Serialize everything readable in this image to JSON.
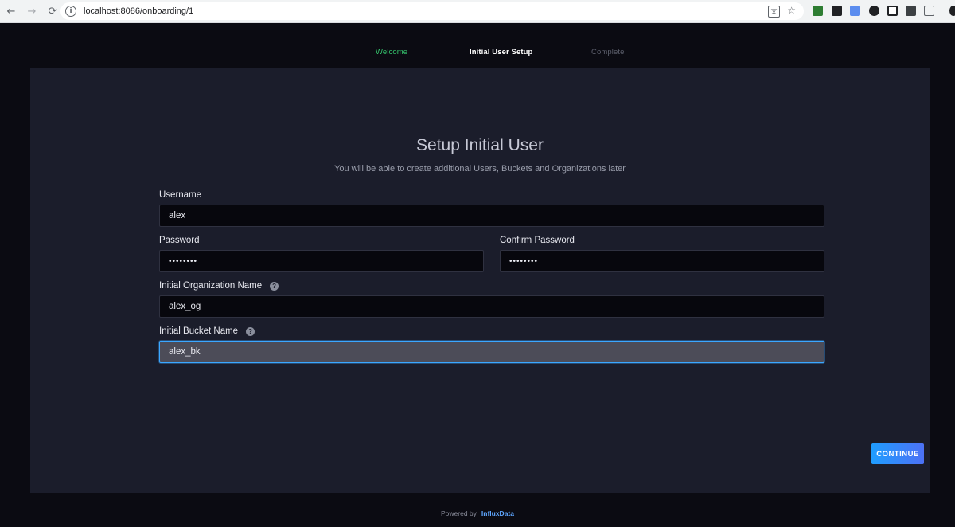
{
  "browser": {
    "url": "localhost:8086/onboarding/1",
    "back_icon": "back-arrow-icon",
    "forward_icon": "forward-arrow-icon",
    "reload_icon": "reload-icon"
  },
  "stepper": {
    "steps": [
      {
        "label": "Welcome",
        "state": "done",
        "color": "#34c16b"
      },
      {
        "label": "Initial User Setup",
        "state": "current",
        "color": "#ffffff"
      },
      {
        "label": "Complete",
        "state": "pending",
        "color": "#5c5f6c"
      }
    ]
  },
  "form": {
    "title": "Setup Initial User",
    "subtitle": "You will be able to create additional Users, Buckets and Organizations later",
    "username": {
      "label": "Username",
      "value": "alex"
    },
    "password": {
      "label": "Password",
      "value": "••••••••"
    },
    "confirm_password": {
      "label": "Confirm Password",
      "value": "••••••••"
    },
    "org": {
      "label": "Initial Organization Name",
      "value": "alex_og",
      "help": "?"
    },
    "bucket": {
      "label": "Initial Bucket Name",
      "value": "alex_bk",
      "help": "?"
    },
    "continue_label": "CONTINUE"
  },
  "footer": {
    "powered_by": "Powered by",
    "brand": "InfluxData"
  },
  "colors": {
    "accent": "#1f9dff",
    "panel": "#1b1d2b",
    "background": "#0b0b12"
  }
}
